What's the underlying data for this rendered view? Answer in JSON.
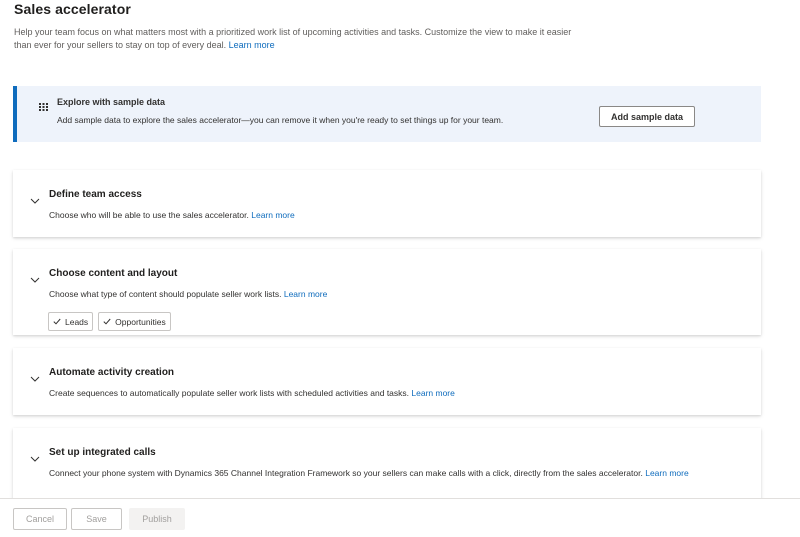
{
  "page": {
    "title": "Sales accelerator",
    "intro_text": "Help your team focus on what matters most with a prioritized work list of upcoming activities and tasks. Customize the view to make it easier than ever for your sellers to stay on top of every deal.",
    "intro_link": "Learn more"
  },
  "banner": {
    "icon": "grid-icon",
    "title": "Explore with sample data",
    "text": "Add sample data to explore the sales accelerator—you can remove it when you're ready to set things up for your team.",
    "button_label": "Add sample data",
    "accent_color": "#0f6cbd"
  },
  "sections": [
    {
      "title": "Define team access",
      "description": "Choose who will be able to use the sales accelerator.",
      "link": "Learn more"
    },
    {
      "title": "Choose content and layout",
      "description": "Choose what type of content should populate seller work lists.",
      "link": "Learn more",
      "chips": [
        "Leads",
        "Opportunities"
      ]
    },
    {
      "title": "Automate activity creation",
      "description": "Create sequences to automatically populate seller work lists with scheduled activities and tasks.",
      "link": "Learn more"
    },
    {
      "title": "Set up integrated calls",
      "description": "Connect your phone system with Dynamics 365 Channel Integration Framework so your sellers can make calls with a click, directly from the sales accelerator.",
      "link": "Learn more"
    }
  ],
  "footer": {
    "cancel_label": "Cancel",
    "save_label": "Save",
    "publish_label": "Publish"
  }
}
